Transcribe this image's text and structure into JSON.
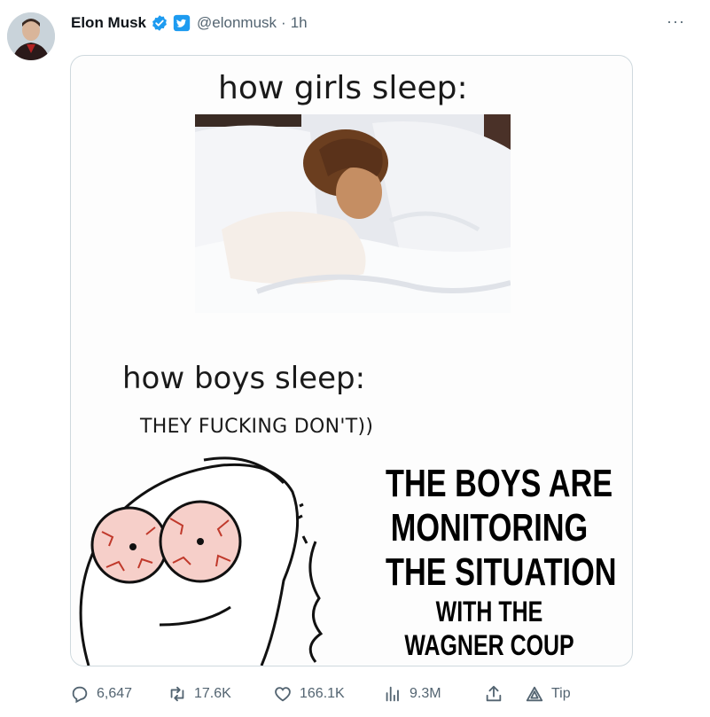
{
  "tweet": {
    "author_name": "Elon Musk",
    "handle": "@elonmusk",
    "separator": "·",
    "time": "1h",
    "more_label": "···"
  },
  "meme": {
    "girls_heading": "how girls sleep:",
    "boys_heading": "how boys sleep:",
    "boys_sub": "THEY FUCKING DON'T))",
    "caption_lines": [
      "THE BOYS ARE",
      "MONITORING",
      "THE SITUATION",
      "WITH THE",
      "WAGNER COUP"
    ]
  },
  "actions": {
    "replies": "6,647",
    "retweets": "17.6K",
    "likes": "166.1K",
    "views": "9.3M",
    "tip": "Tip"
  },
  "colors": {
    "verified_blue": "#1d9bf0",
    "muted_text": "#536471",
    "border": "#cfd9de"
  }
}
